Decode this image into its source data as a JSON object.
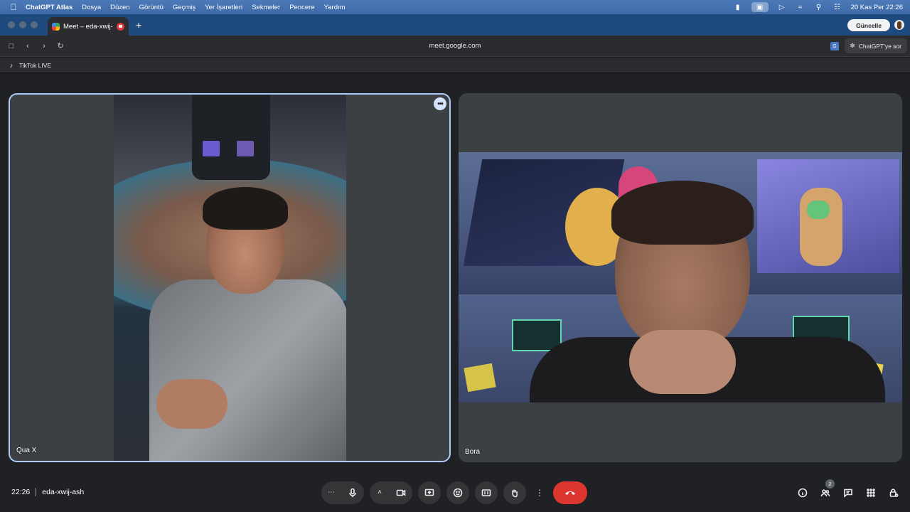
{
  "menubar": {
    "app_name": "ChatGPT Atlas",
    "items": [
      "Dosya",
      "Düzen",
      "Görüntü",
      "Geçmiş",
      "Yer İşaretleri",
      "Sekmeler",
      "Pencere",
      "Yardım"
    ],
    "clock": "20 Kas Per  22:26"
  },
  "browser": {
    "tab_title": "Meet – eda-xwij-ash",
    "url": "meet.google.com",
    "update_label": "Güncelle",
    "ask_label": "ChatGPT'ye sor",
    "bookmark_label": "TikTok LIVE"
  },
  "meet": {
    "participants": [
      {
        "name": "Qua X"
      },
      {
        "name": "Bora"
      }
    ],
    "time": "22:26",
    "meeting_code": "eda-xwij-ash",
    "participant_count": "2"
  },
  "colors": {
    "end_call": "#dc362e",
    "active_tile_border": "#aecbfa",
    "menubar": "#4c79b8"
  }
}
